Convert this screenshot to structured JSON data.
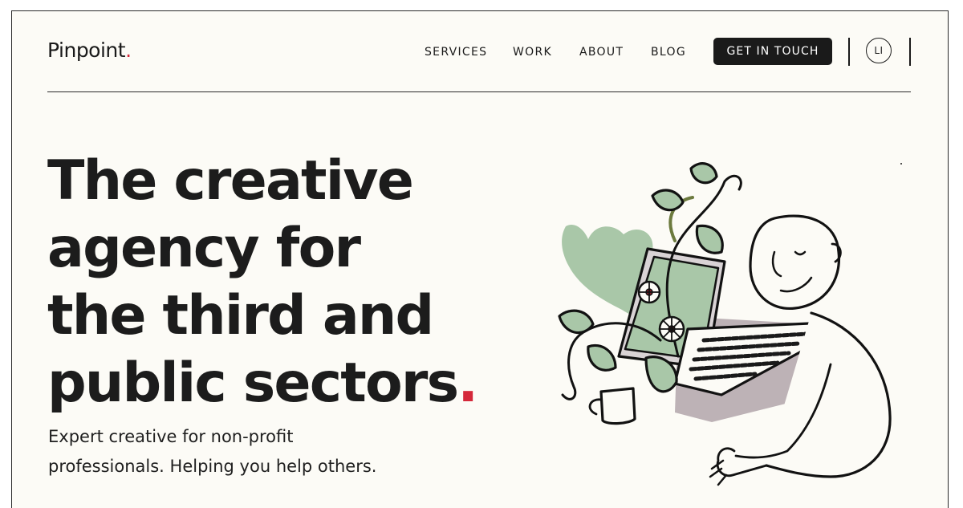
{
  "brand": {
    "name": "Pinpoint",
    "dot": ".",
    "dot_color": "#d4283a"
  },
  "nav": {
    "items": [
      {
        "label": "SERVICES"
      },
      {
        "label": "WORK"
      },
      {
        "label": "ABOUT"
      },
      {
        "label": "BLOG"
      }
    ],
    "cta_label": "GET IN TOUCH",
    "linkedin_label": "LI"
  },
  "hero": {
    "title_lines": [
      "The creative",
      "agency for",
      "the third and",
      "public sectors"
    ],
    "title_dot": ".",
    "subtitle_lines": [
      "Expert creative for non-profit",
      "professionals. Helping you help others."
    ]
  },
  "colors": {
    "background": "#fcfbf6",
    "text": "#1a1a1a",
    "accent": "#d4283a",
    "illustration_green": "#a9c7a8",
    "illustration_grey": "#bdb2b6"
  },
  "illustration": {
    "icon": "person-at-laptop-with-plants-illustration"
  }
}
